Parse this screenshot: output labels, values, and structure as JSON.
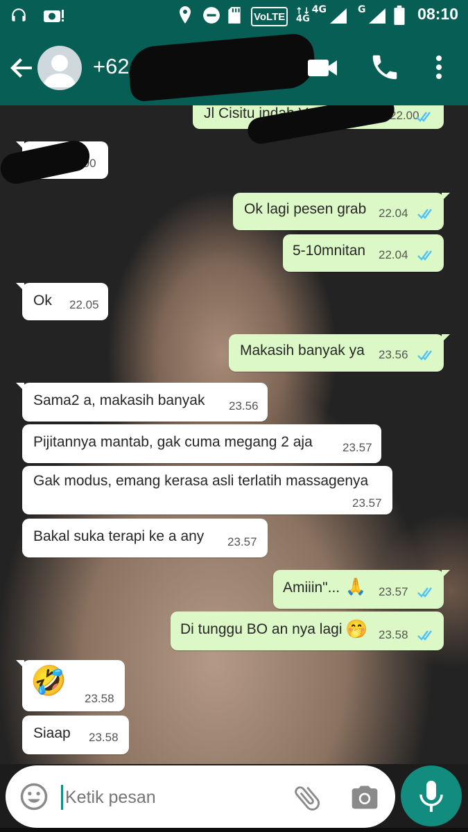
{
  "status_bar": {
    "time": "08:10",
    "icons": [
      "headset-icon",
      "camera-notification-icon",
      "location-icon",
      "do-not-disturb-icon",
      "sd-card-icon",
      "volte-icon",
      "signal-4g-icon",
      "signal-g-icon",
      "battery-icon"
    ],
    "volte_label": "VoLTE",
    "net1_label": "4G",
    "net2_label": "G"
  },
  "header": {
    "contact": "+62 857 6070 43...",
    "icons": [
      "back-arrow-icon",
      "avatar-icon",
      "video-call-icon",
      "phone-icon",
      "more-vert-icon"
    ],
    "accent_color": "#075e54"
  },
  "messages": [
    {
      "dir": "out",
      "text": "Jl Cisitu indah V ...",
      "time": "22.00",
      "ticks": true
    },
    {
      "dir": "in",
      "text": "",
      "time": "22.00"
    },
    {
      "dir": "out",
      "text": "Ok lagi pesen grab",
      "time": "22.04",
      "ticks": true
    },
    {
      "dir": "out",
      "text": "5-10mnitan",
      "time": "22.04",
      "ticks": true
    },
    {
      "dir": "in",
      "text": "Ok",
      "time": "22.05"
    },
    {
      "dir": "out",
      "text": "Makasih banyak ya",
      "time": "23.56",
      "ticks": true
    },
    {
      "dir": "in",
      "text": "Sama2 a, makasih banyak",
      "time": "23.56"
    },
    {
      "dir": "in",
      "text": "Pijitannya mantab, gak cuma megang 2 aja",
      "time": "23.57"
    },
    {
      "dir": "in",
      "text": "Gak modus, emang kerasa asli terlatih massagenya",
      "time": "23.57"
    },
    {
      "dir": "in",
      "text": "Bakal suka terapi ke a any",
      "time": "23.57"
    },
    {
      "dir": "out",
      "text": "Amiiin\"...",
      "emoji": "🙏",
      "time": "23.57",
      "ticks": true
    },
    {
      "dir": "out",
      "text": "Di tunggu BO an nya lagi",
      "emoji": "🤭",
      "time": "23.58",
      "ticks": true
    },
    {
      "dir": "in",
      "text": "",
      "emoji": "🤣",
      "time": "23.58"
    },
    {
      "dir": "in",
      "text": "Siaap",
      "time": "23.58"
    }
  ],
  "colors": {
    "bubble_out": "#dcf8c6",
    "bubble_in": "#ffffff",
    "tick_read": "#4fc3f7"
  },
  "input": {
    "placeholder": "Ketik pesan",
    "icons": [
      "emoji-icon",
      "attach-icon",
      "camera-icon",
      "mic-icon"
    ]
  }
}
